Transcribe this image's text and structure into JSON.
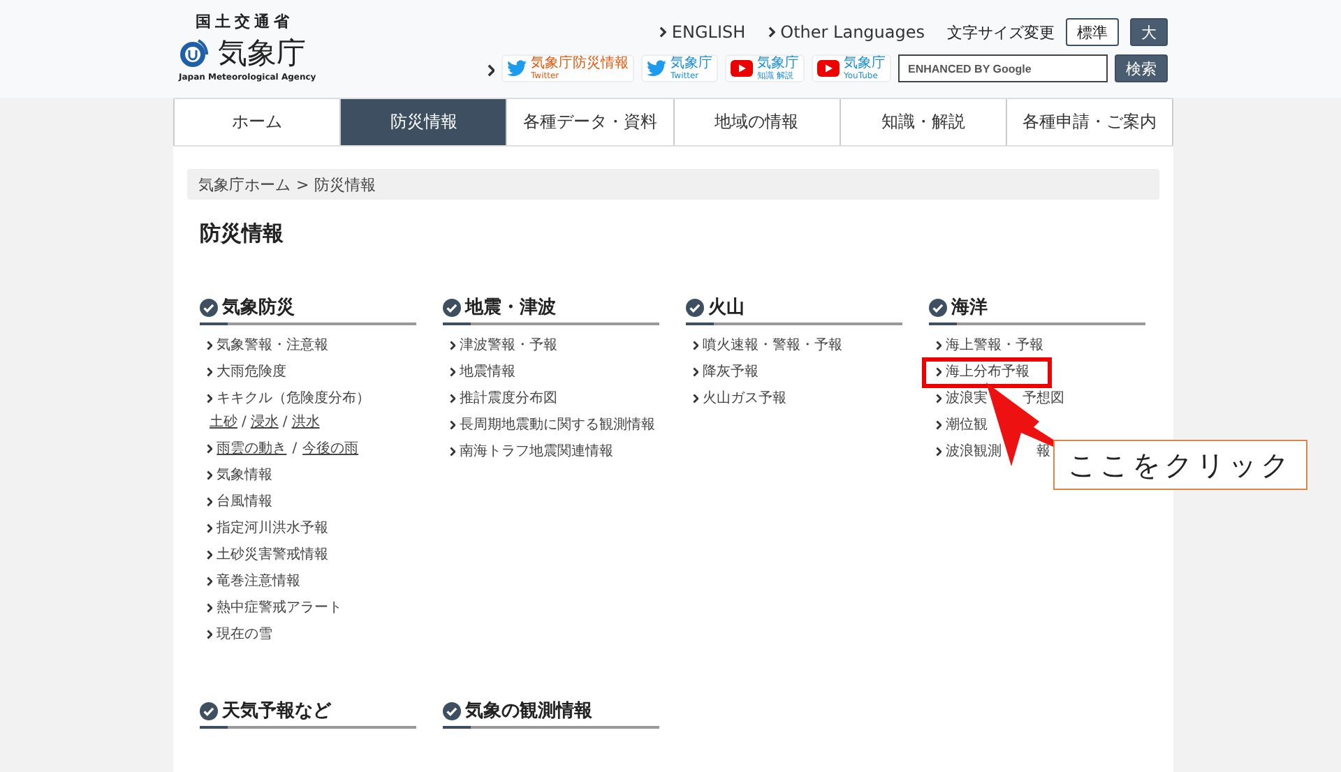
{
  "header": {
    "ministry": "国土交通省",
    "agency": "気象庁",
    "agency_en": "Japan Meteorological Agency",
    "language_links": [
      "ENGLISH",
      "Other Languages"
    ],
    "font_size": {
      "label": "文字サイズ変更",
      "options": [
        {
          "label": "標準",
          "selected": true
        },
        {
          "label": "大",
          "selected": false
        }
      ]
    },
    "social": [
      {
        "kind": "twitter",
        "lines": [
          "気象庁防災情報",
          "Twitter"
        ],
        "color": "#e8590c"
      },
      {
        "kind": "twitter",
        "lines": [
          "気象庁",
          "Twitter"
        ],
        "color": "#1d8fd8"
      },
      {
        "kind": "youtube",
        "lines": [
          "気象庁",
          "知識 解説"
        ],
        "color": "#1d8fd8"
      },
      {
        "kind": "youtube",
        "lines": [
          "気象庁",
          "YouTube"
        ],
        "color": "#1d8fd8"
      }
    ],
    "search": {
      "placeholder": "ENHANCED BY Google",
      "button": "検索"
    }
  },
  "nav": [
    {
      "label": "ホーム",
      "selected": false
    },
    {
      "label": "防災情報",
      "selected": true
    },
    {
      "label": "各種データ・資料",
      "selected": false
    },
    {
      "label": "地域の情報",
      "selected": false
    },
    {
      "label": "知識・解説",
      "selected": false
    },
    {
      "label": "各種申請・ご案内",
      "selected": false
    }
  ],
  "breadcrumb": [
    "気象庁ホーム",
    ">",
    "防災情報"
  ],
  "page_title": "防災情報",
  "sections": [
    {
      "title": "気象防災",
      "items": [
        {
          "kind": "plain",
          "text": "気象警報・注意報"
        },
        {
          "kind": "plain",
          "text": "大雨危険度"
        },
        {
          "kind": "sublinks",
          "text": "キキクル（危険度分布）",
          "links": [
            "土砂",
            "浸水",
            "洪水"
          ],
          "separator": "/"
        },
        {
          "kind": "links",
          "links": [
            "雨雲の動き",
            "今後の雨"
          ],
          "separator": "/"
        },
        {
          "kind": "plain",
          "text": "気象情報"
        },
        {
          "kind": "plain",
          "text": "台風情報"
        },
        {
          "kind": "plain",
          "text": "指定河川洪水予報"
        },
        {
          "kind": "plain",
          "text": "土砂災害警戒情報"
        },
        {
          "kind": "plain",
          "text": "竜巻注意情報"
        },
        {
          "kind": "plain",
          "text": "熱中症警戒アラート"
        },
        {
          "kind": "plain",
          "text": "現在の雪"
        }
      ]
    },
    {
      "title": "地震・津波",
      "items": [
        {
          "kind": "plain",
          "text": "津波警報・予報"
        },
        {
          "kind": "plain",
          "text": "地震情報"
        },
        {
          "kind": "plain",
          "text": "推計震度分布図"
        },
        {
          "kind": "plain",
          "text": "長周期地震動に関する観測情報"
        },
        {
          "kind": "plain",
          "text": "南海トラフ地震関連情報"
        }
      ]
    },
    {
      "title": "火山",
      "items": [
        {
          "kind": "plain",
          "text": "噴火速報・警報・予報"
        },
        {
          "kind": "plain",
          "text": "降灰予報"
        },
        {
          "kind": "plain",
          "text": "火山ガス予報"
        }
      ]
    },
    {
      "title": "海洋",
      "items": [
        {
          "kind": "plain",
          "text": "海上警報・予報"
        },
        {
          "kind": "plain",
          "text": "海上分布予報",
          "highlighted": true
        },
        {
          "kind": "split",
          "parts": [
            "波浪実",
            "予想図"
          ]
        },
        {
          "kind": "plain",
          "text": "潮位観"
        },
        {
          "kind": "split",
          "parts": [
            "波浪観測",
            "報"
          ]
        }
      ]
    },
    {
      "title": "天気予報など"
    },
    {
      "title": "気象の観測情報"
    }
  ],
  "callout": "ここをクリック"
}
